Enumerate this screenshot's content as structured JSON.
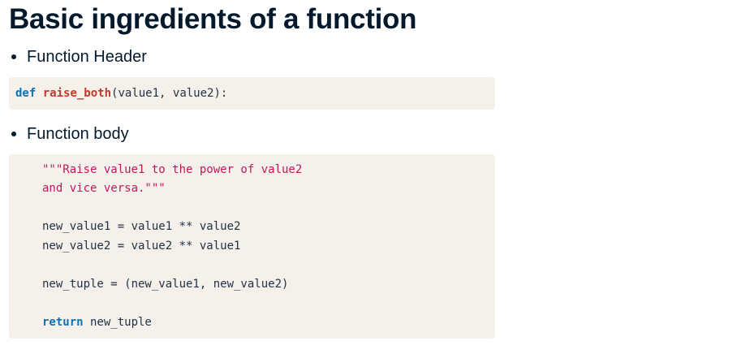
{
  "title": "Basic ingredients of a function",
  "bullets": [
    "Function Header",
    "Function body"
  ],
  "header_code": {
    "keyword": "def",
    "function_name": "raise_both",
    "signature": "(value1, value2):"
  },
  "body_code": {
    "docstring_line1": "\"\"\"Raise value1 to the power of value2",
    "docstring_line2": "and vice versa.\"\"\"",
    "line_new_value1": "new_value1 = value1 ** value2",
    "line_new_value2": "new_value2 = value2 ** value1",
    "line_new_tuple": "new_tuple = (new_value1, new_value2)",
    "return_keyword": "return",
    "return_value": " new_tuple"
  },
  "colors": {
    "heading": "#05192d",
    "code_background": "#f5f1ea",
    "keyword": "#0c72b6",
    "function_name": "#c0392b",
    "string": "#c2185b"
  }
}
